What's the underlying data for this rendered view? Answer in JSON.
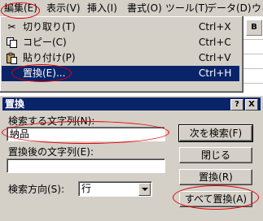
{
  "menubar": {
    "items": [
      {
        "label": "編集(E)"
      },
      {
        "label": "表示(V)"
      },
      {
        "label": "挿入(I)"
      },
      {
        "label": "書式(O)"
      },
      {
        "label": "ツール(T)"
      },
      {
        "label": "データ(D)"
      },
      {
        "label": "ウィ"
      }
    ]
  },
  "edit_menu": {
    "items": [
      {
        "label": "切り取り(T)",
        "shortcut": "Ctrl+X",
        "icon": "scissors-icon"
      },
      {
        "label": "コピー(C)",
        "shortcut": "Ctrl+C",
        "icon": "copy-icon"
      },
      {
        "label": "貼り付け(P)",
        "shortcut": "Ctrl+V",
        "icon": "paste-icon"
      },
      {
        "label": "置換(E)...",
        "shortcut": "Ctrl+H",
        "icon": "",
        "selected": true
      }
    ]
  },
  "toolbar": {
    "bold_label": "B"
  },
  "dialog": {
    "title": "置換",
    "help_label": "?",
    "close_label": "X",
    "find_label": "検索する文字列(N):",
    "find_value": "納品",
    "replace_label": "置換後の文字列(E):",
    "replace_value": "",
    "direction_label": "検索方向(S):",
    "direction_value": "行",
    "buttons": {
      "find_next": "次を検索(F)",
      "close": "閉じる",
      "replace": "置換(R)",
      "replace_all": "すべて置換(A)"
    }
  },
  "colors": {
    "menu_bg": "#d4d0c8",
    "highlight": "#0a246a",
    "annotation": "#e60000"
  }
}
